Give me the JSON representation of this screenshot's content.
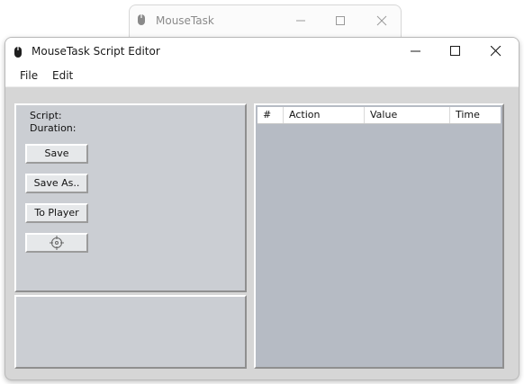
{
  "background_window": {
    "title": "MouseTask",
    "icon": "mouse-icon",
    "controls": [
      "minimize-icon",
      "maximize-icon",
      "close-icon"
    ]
  },
  "window": {
    "title": "MouseTask Script Editor",
    "icon": "mouse-icon",
    "controls": [
      "minimize-icon",
      "maximize-icon",
      "close-icon"
    ]
  },
  "menu": {
    "file": "File",
    "edit": "Edit"
  },
  "info": {
    "script_label": "Script:",
    "duration_label": "Duration:"
  },
  "buttons": {
    "save": "Save",
    "save_as": "Save As..",
    "to_player": "To Player",
    "target_icon": "crosshair-icon"
  },
  "table": {
    "columns": [
      "#",
      "Action",
      "Value",
      "Time"
    ],
    "rows": []
  },
  "colors": {
    "window_bg": "#d6d6d6",
    "panel_bg": "#cbced3",
    "table_bg": "#b6bbc4"
  }
}
